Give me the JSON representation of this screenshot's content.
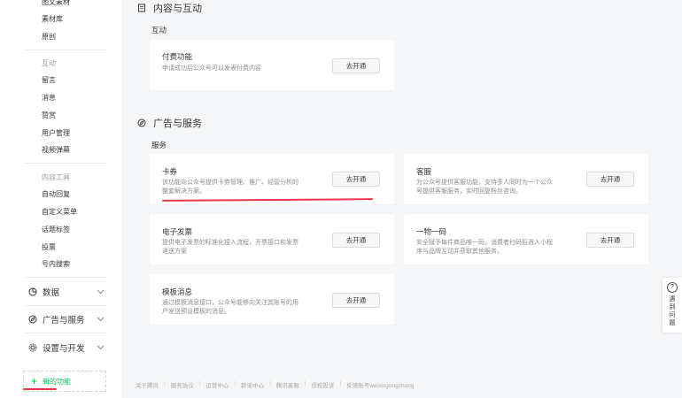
{
  "sidebar": {
    "top_items": [
      "图文素材",
      "素材库",
      "原创"
    ],
    "groups": [
      {
        "label": "互动",
        "items": [
          "留言",
          "消息",
          "赞赏",
          "用户管理",
          "视频弹幕"
        ]
      },
      {
        "label": "内容工具",
        "items": [
          "自动回复",
          "自定义菜单",
          "话题标签",
          "投票",
          "号内搜索"
        ]
      }
    ],
    "sections": [
      {
        "label": "数据",
        "icon": "chart-icon"
      },
      {
        "label": "广告与服务",
        "icon": "compass-icon"
      },
      {
        "label": "设置与开发",
        "icon": "gear-icon"
      }
    ],
    "new_function": {
      "plus": "+",
      "label": "新的功能"
    }
  },
  "content_section": {
    "title": "内容与互动",
    "subsection": "互动",
    "card": {
      "title": "付费功能",
      "desc": "申请成功后公众号可以发表付费内容",
      "button": "去开通"
    }
  },
  "ad_section": {
    "title": "广告与服务",
    "subsection": "服务",
    "cards": [
      {
        "title": "卡券",
        "desc1": "该功能向公众号提供卡券管理、推广、经营分析的",
        "desc2": "整套解决方案。",
        "button": "去开通"
      },
      {
        "title": "客服",
        "desc1": "为公众号提供客服功能，支持多人同时为一个公众",
        "desc2": "号提供客服服务，实时回复粉丝咨询。",
        "button": "去开通"
      },
      {
        "title": "电子发票",
        "desc1": "提供电子发票的标准化接入流程，开票接口和发票",
        "desc2": "递送方案",
        "button": "去开通"
      },
      {
        "title": "一物一码",
        "desc1": "安全赋予每件商品唯一码，消费者扫码后进入小程",
        "desc2": "序与品牌互动并获取其他服务。",
        "button": "去开通"
      },
      {
        "title": "模板消息",
        "desc1": "通过模板消息接口，公众号能够向关注其账号的用",
        "desc2": "户发送预设模板的消息。",
        "button": "去开通"
      }
    ]
  },
  "footer": [
    "关于腾讯",
    "服务协议",
    "运营中心",
    "辟谣中心",
    "腾讯客服",
    "侵权投诉",
    "反馈账号weixingongzhong"
  ],
  "help_float": {
    "icon": "?",
    "label": "遇到问题"
  },
  "colors": {
    "accent_green": "#07c160",
    "annotation_red": "#e8364a",
    "background": "#f5f6f7"
  }
}
